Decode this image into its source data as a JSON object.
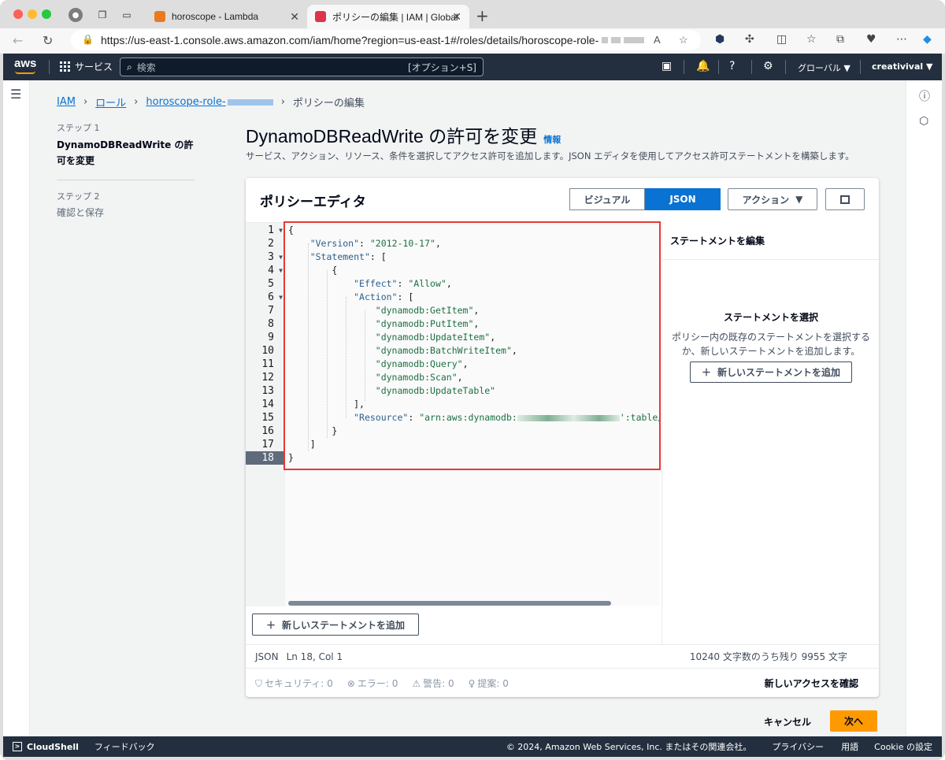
{
  "browser": {
    "tabs": [
      {
        "label": "horoscope - Lambda",
        "favicon_color": "#e87b1e"
      },
      {
        "label": "ポリシーの編集 | IAM | Global",
        "favicon_color": "#dd344c"
      }
    ],
    "url": "https://us-east-1.console.aws.amazon.com/iam/home?region=us-east-1#/roles/details/horoscope-role-",
    "reader_mode_label": "A"
  },
  "aws_header": {
    "logo": "aws",
    "services_label": "サービス",
    "search_placeholder": "検索",
    "search_shortcut": "[オプション+S]",
    "region_label": "グローバル ▼",
    "account_label": "creativival ▼"
  },
  "breadcrumb": {
    "items": [
      "IAM",
      "ロール",
      "horoscope-role-",
      "ポリシーの編集"
    ]
  },
  "steps": [
    {
      "label": "ステップ 1",
      "title": "DynamoDBReadWrite の許可を変更"
    },
    {
      "label": "ステップ 2",
      "title": "確認と保存"
    }
  ],
  "page": {
    "title": "DynamoDBReadWrite の許可を変更",
    "info_link": "情報",
    "subtitle": "サービス、アクション、リソース、条件を選択してアクセス許可を追加します。JSON エディタを使用してアクセス許可ステートメントを構築します。"
  },
  "editor_card": {
    "title": "ポリシーエディタ",
    "mode_visual": "ビジュアル",
    "mode_json": "JSON",
    "actions_label": "アクション",
    "line_numbers": [
      "1",
      "2",
      "3",
      "4",
      "5",
      "6",
      "7",
      "8",
      "9",
      "10",
      "11",
      "12",
      "13",
      "14",
      "15",
      "16",
      "17",
      "18"
    ],
    "code": {
      "l1": "{",
      "l2_key": "\"Version\"",
      "l2_val": "\"2012-10-17\"",
      "l3_key": "\"Statement\"",
      "l4": "{",
      "l5_key": "\"Effect\"",
      "l5_val": "\"Allow\"",
      "l6_key": "\"Action\"",
      "l7": "\"dynamodb:GetItem\"",
      "l8": "\"dynamodb:PutItem\"",
      "l9": "\"dynamodb:UpdateItem\"",
      "l10": "\"dynamodb:BatchWriteItem\"",
      "l11": "\"dynamodb:Query\"",
      "l12": "\"dynamodb:Scan\"",
      "l13": "\"dynamodb:UpdateTable\"",
      "l14": "],",
      "l15_key": "\"Resource\"",
      "l15_val_start": "\"arn:aws:dynamodb:",
      "l15_val_end": "':table/H",
      "l16": "}",
      "l17": "]",
      "l18": "}"
    },
    "add_statement_label": "新しいステートメントを追加",
    "status_mode": "JSON",
    "status_pos": "Ln 18, Col 1",
    "status_remaining": "10240 文字数のうち残り 9955 文字",
    "checks": {
      "security": "セキュリティ: 0",
      "errors": "エラー: 0",
      "warnings": "警告: 0",
      "suggestions": "提案: 0"
    },
    "confirm_access": "新しいアクセスを確認",
    "side_panel": {
      "header": "ステートメントを編集",
      "empty_title": "ステートメントを選択",
      "empty_text": "ポリシー内の既存のステートメントを選択するか、新しいステートメントを追加します。",
      "add_label": "新しいステートメントを追加"
    }
  },
  "footer_actions": {
    "cancel": "キャンセル",
    "next": "次へ"
  },
  "footer": {
    "cloudshell": "CloudShell",
    "feedback": "フィードバック",
    "copyright": "© 2024, Amazon Web Services, Inc. またはその関連会社。",
    "privacy": "プライバシー",
    "terms": "用語",
    "cookie": "Cookie の設定"
  },
  "colors": {
    "aws_nav": "#232f3e",
    "primary": "#0972d3",
    "accent_orange": "#ff9900",
    "highlight_red": "#e53935"
  }
}
